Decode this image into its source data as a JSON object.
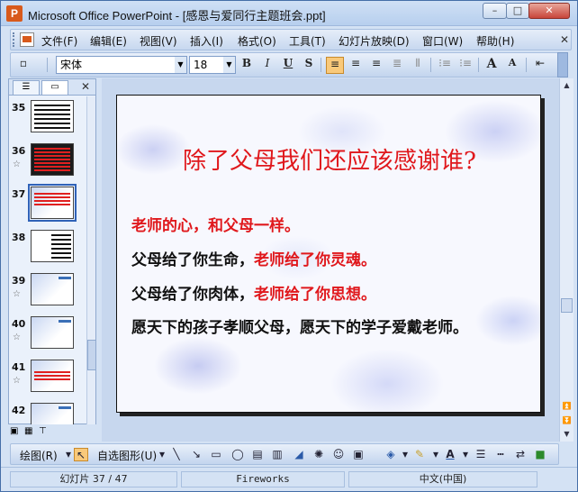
{
  "window": {
    "app_icon": "P",
    "title": "Microsoft Office PowerPoint - [感恩与爱同行主题班会.ppt]",
    "min": "–",
    "max": "□",
    "close": "✕"
  },
  "menu": {
    "items": [
      "文件(F)",
      "编辑(E)",
      "视图(V)",
      "插入(I)",
      "格式(O)",
      "工具(T)",
      "幻灯片放映(D)",
      "窗口(W)",
      "帮助(H)"
    ],
    "close_x": "✕"
  },
  "toolbar": {
    "font_name": "宋体",
    "font_size": "18",
    "bold": "B",
    "italic": "I",
    "underline": "U",
    "shadow": "S",
    "grow_font": "A",
    "shrink_font": "A"
  },
  "outline_pane": {
    "close": "✕",
    "thumbnails": [
      {
        "number": "35",
        "star": ""
      },
      {
        "number": "36",
        "star": "☆"
      },
      {
        "number": "37",
        "star": ""
      },
      {
        "number": "38",
        "star": ""
      },
      {
        "number": "39",
        "star": "☆"
      },
      {
        "number": "40",
        "star": "☆"
      },
      {
        "number": "41",
        "star": "☆"
      },
      {
        "number": "42",
        "star": ""
      }
    ]
  },
  "slide": {
    "title": "除了父母我们还应该感谢谁?",
    "line1": "老师的心，和父母一样。",
    "line2_black": "父母给了你生命，",
    "line2_red": "老师给了你灵魂。",
    "line3_black": "父母给了你肉体，",
    "line3_red": "老师给了你思想。",
    "line4": "愿天下的孩子孝顺父母，愿天下的学子爱戴老师。"
  },
  "drawing_toolbar": {
    "draw_label": "绘图(R)",
    "autoshapes_label": "自选图形(U)"
  },
  "status": {
    "slide_position": "幻灯片 37 / 47",
    "design": "Fireworks",
    "language": "中文(中国)"
  }
}
